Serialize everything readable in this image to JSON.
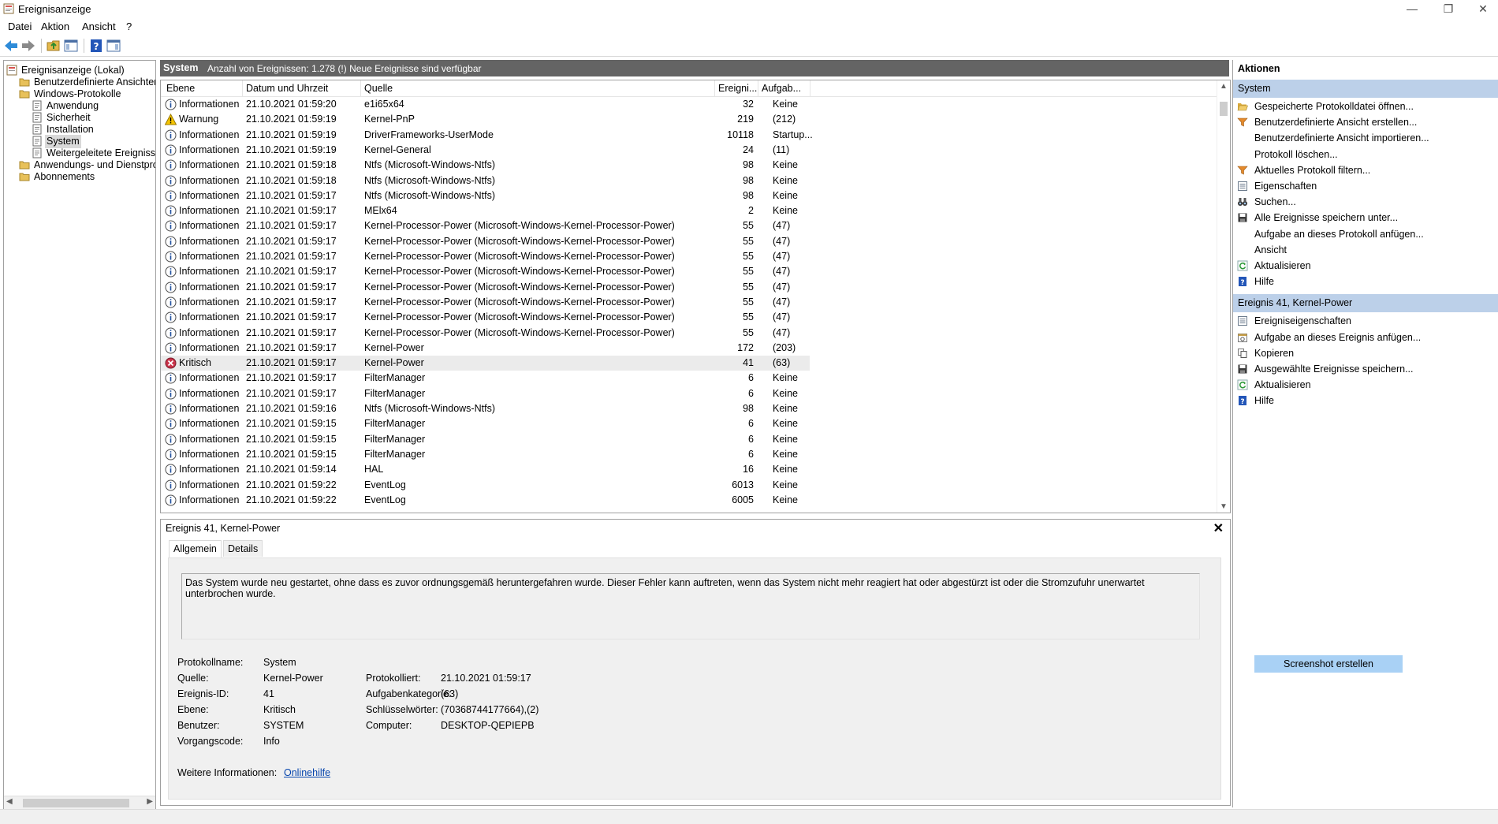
{
  "window": {
    "title": "Ereignisanzeige",
    "minimize": "—",
    "restore": "❐",
    "close": "✕"
  },
  "menu": [
    "Datei",
    "Aktion",
    "Ansicht",
    "?"
  ],
  "toolbar_icons": [
    "back-arrow-icon",
    "forward-arrow-icon",
    "folder-up-icon",
    "console-tree-icon",
    "help-icon",
    "action-pane-icon"
  ],
  "tree": [
    {
      "label": "Ereignisanzeige (Lokal)",
      "indent": 0,
      "icon": "event-viewer-icon"
    },
    {
      "label": "Benutzerdefinierte Ansichten",
      "indent": 1,
      "icon": "folder-icon"
    },
    {
      "label": "Windows-Protokolle",
      "indent": 1,
      "icon": "folder-icon"
    },
    {
      "label": "Anwendung",
      "indent": 2,
      "icon": "log-icon"
    },
    {
      "label": "Sicherheit",
      "indent": 2,
      "icon": "log-icon"
    },
    {
      "label": "Installation",
      "indent": 2,
      "icon": "log-icon"
    },
    {
      "label": "System",
      "indent": 2,
      "icon": "log-icon",
      "selected": true
    },
    {
      "label": "Weitergeleitete Ereignisse",
      "indent": 2,
      "icon": "log-icon"
    },
    {
      "label": "Anwendungs- und Dienstproto",
      "indent": 1,
      "icon": "folder-icon"
    },
    {
      "label": "Abonnements",
      "indent": 1,
      "icon": "folder-icon"
    }
  ],
  "center": {
    "name": "System",
    "count_text": "Anzahl von Ereignissen: 1.278 (!) Neue Ereignisse sind verfügbar",
    "columns": [
      "Ebene",
      "Datum und Uhrzeit",
      "Quelle",
      "Ereigni...",
      "Aufgab..."
    ],
    "rows": [
      [
        "info",
        "Informationen",
        "21.10.2021 01:59:20",
        "e1i65x64",
        "32",
        "Keine"
      ],
      [
        "warn",
        "Warnung",
        "21.10.2021 01:59:19",
        "Kernel-PnP",
        "219",
        "(212)"
      ],
      [
        "info",
        "Informationen",
        "21.10.2021 01:59:19",
        "DriverFrameworks-UserMode",
        "10118",
        "Startup..."
      ],
      [
        "info",
        "Informationen",
        "21.10.2021 01:59:19",
        "Kernel-General",
        "24",
        "(11)"
      ],
      [
        "info",
        "Informationen",
        "21.10.2021 01:59:18",
        "Ntfs (Microsoft-Windows-Ntfs)",
        "98",
        "Keine"
      ],
      [
        "info",
        "Informationen",
        "21.10.2021 01:59:18",
        "Ntfs (Microsoft-Windows-Ntfs)",
        "98",
        "Keine"
      ],
      [
        "info",
        "Informationen",
        "21.10.2021 01:59:17",
        "Ntfs (Microsoft-Windows-Ntfs)",
        "98",
        "Keine"
      ],
      [
        "info",
        "Informationen",
        "21.10.2021 01:59:17",
        "MElx64",
        "2",
        "Keine"
      ],
      [
        "info",
        "Informationen",
        "21.10.2021 01:59:17",
        "Kernel-Processor-Power (Microsoft-Windows-Kernel-Processor-Power)",
        "55",
        "(47)"
      ],
      [
        "info",
        "Informationen",
        "21.10.2021 01:59:17",
        "Kernel-Processor-Power (Microsoft-Windows-Kernel-Processor-Power)",
        "55",
        "(47)"
      ],
      [
        "info",
        "Informationen",
        "21.10.2021 01:59:17",
        "Kernel-Processor-Power (Microsoft-Windows-Kernel-Processor-Power)",
        "55",
        "(47)"
      ],
      [
        "info",
        "Informationen",
        "21.10.2021 01:59:17",
        "Kernel-Processor-Power (Microsoft-Windows-Kernel-Processor-Power)",
        "55",
        "(47)"
      ],
      [
        "info",
        "Informationen",
        "21.10.2021 01:59:17",
        "Kernel-Processor-Power (Microsoft-Windows-Kernel-Processor-Power)",
        "55",
        "(47)"
      ],
      [
        "info",
        "Informationen",
        "21.10.2021 01:59:17",
        "Kernel-Processor-Power (Microsoft-Windows-Kernel-Processor-Power)",
        "55",
        "(47)"
      ],
      [
        "info",
        "Informationen",
        "21.10.2021 01:59:17",
        "Kernel-Processor-Power (Microsoft-Windows-Kernel-Processor-Power)",
        "55",
        "(47)"
      ],
      [
        "info",
        "Informationen",
        "21.10.2021 01:59:17",
        "Kernel-Processor-Power (Microsoft-Windows-Kernel-Processor-Power)",
        "55",
        "(47)"
      ],
      [
        "info",
        "Informationen",
        "21.10.2021 01:59:17",
        "Kernel-Power",
        "172",
        "(203)"
      ],
      [
        "crit",
        "Kritisch",
        "21.10.2021 01:59:17",
        "Kernel-Power",
        "41",
        "(63)"
      ],
      [
        "info",
        "Informationen",
        "21.10.2021 01:59:17",
        "FilterManager",
        "6",
        "Keine"
      ],
      [
        "info",
        "Informationen",
        "21.10.2021 01:59:17",
        "FilterManager",
        "6",
        "Keine"
      ],
      [
        "info",
        "Informationen",
        "21.10.2021 01:59:16",
        "Ntfs (Microsoft-Windows-Ntfs)",
        "98",
        "Keine"
      ],
      [
        "info",
        "Informationen",
        "21.10.2021 01:59:15",
        "FilterManager",
        "6",
        "Keine"
      ],
      [
        "info",
        "Informationen",
        "21.10.2021 01:59:15",
        "FilterManager",
        "6",
        "Keine"
      ],
      [
        "info",
        "Informationen",
        "21.10.2021 01:59:15",
        "FilterManager",
        "6",
        "Keine"
      ],
      [
        "info",
        "Informationen",
        "21.10.2021 01:59:14",
        "HAL",
        "16",
        "Keine"
      ],
      [
        "info",
        "Informationen",
        "21.10.2021 01:59:22",
        "EventLog",
        "6013",
        "Keine"
      ],
      [
        "info",
        "Informationen",
        "21.10.2021 01:59:22",
        "EventLog",
        "6005",
        "Keine"
      ]
    ],
    "selected_row": 17
  },
  "detail": {
    "title": "Ereignis 41, Kernel-Power",
    "tabs": [
      "Allgemein",
      "Details"
    ],
    "description": "Das System wurde neu gestartet, ohne dass es zuvor ordnungsgemäß heruntergefahren wurde. Dieser Fehler kann auftreten, wenn das System nicht mehr reagiert hat oder abgestürzt ist oder die Stromzufuhr unerwartet unterbrochen wurde.",
    "props_left": [
      [
        "Protokollname:",
        "System"
      ],
      [
        "Quelle:",
        "Kernel-Power"
      ],
      [
        "Ereignis-ID:",
        "41"
      ],
      [
        "Ebene:",
        "Kritisch"
      ],
      [
        "Benutzer:",
        "SYSTEM"
      ],
      [
        "Vorgangscode:",
        "Info"
      ]
    ],
    "props_right": [
      [
        "Protokolliert:",
        "21.10.2021 01:59:17"
      ],
      [
        "Aufgabenkategorie:",
        "(63)"
      ],
      [
        "Schlüsselwörter:",
        "(70368744177664),(2)"
      ],
      [
        "Computer:",
        "DESKTOP-QEPIEPB"
      ]
    ],
    "more_info_label": "Weitere Informationen:",
    "more_info_link": "Onlinehilfe"
  },
  "actions": {
    "title": "Aktionen",
    "sections": [
      {
        "title": "System",
        "items": [
          [
            "open-folder-icon",
            "Gespeicherte Protokolldatei öffnen..."
          ],
          [
            "filter-icon",
            "Benutzerdefinierte Ansicht erstellen..."
          ],
          [
            "",
            "Benutzerdefinierte Ansicht importieren..."
          ],
          [
            "",
            "Protokoll löschen..."
          ],
          [
            "filter-icon",
            "Aktuelles Protokoll filtern..."
          ],
          [
            "properties-icon",
            "Eigenschaften"
          ],
          [
            "binoculars-icon",
            "Suchen..."
          ],
          [
            "save-icon",
            "Alle Ereignisse speichern unter..."
          ],
          [
            "",
            "Aufgabe an dieses Protokoll anfügen..."
          ],
          [
            "",
            "Ansicht"
          ],
          [
            "refresh-icon",
            "Aktualisieren"
          ],
          [
            "help-icon",
            "Hilfe"
          ]
        ]
      },
      {
        "title": "Ereignis 41, Kernel-Power",
        "items": [
          [
            "properties-icon",
            "Ereigniseigenschaften"
          ],
          [
            "task-icon",
            "Aufgabe an dieses Ereignis anfügen..."
          ],
          [
            "copy-icon",
            "Kopieren"
          ],
          [
            "save-icon",
            "Ausgewählte Ereignisse speichern..."
          ],
          [
            "refresh-icon",
            "Aktualisieren"
          ],
          [
            "help-icon",
            "Hilfe"
          ]
        ]
      }
    ]
  },
  "screenshot_button": "Screenshot erstellen",
  "colors": {
    "header_bg": "#646464",
    "section_bg": "#bcd0e9",
    "button_bg": "#a9d1f5",
    "link": "#0645ad"
  }
}
